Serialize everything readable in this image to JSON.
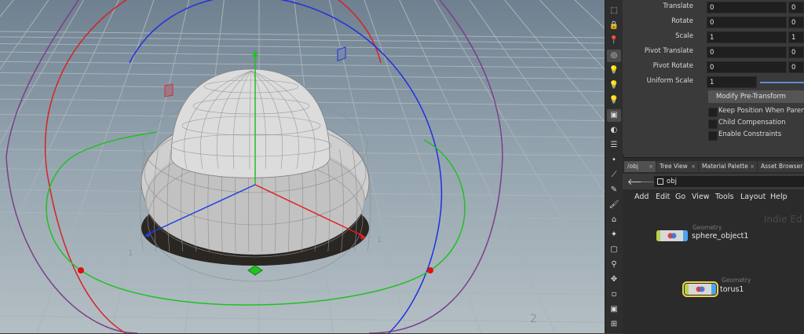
{
  "parameters": [
    {
      "label": "Translate",
      "values": [
        "0",
        "0"
      ]
    },
    {
      "label": "Rotate",
      "values": [
        "0",
        "0"
      ]
    },
    {
      "label": "Scale",
      "values": [
        "1",
        "1"
      ]
    },
    {
      "label": "Pivot Translate",
      "values": [
        "0",
        "0"
      ]
    },
    {
      "label": "Pivot Rotate",
      "values": [
        "0",
        "0"
      ]
    },
    {
      "label": "Uniform Scale",
      "values": [
        "1"
      ]
    }
  ],
  "pretransform_button": "Modify Pre-Transform",
  "checkboxes": [
    {
      "label": "Keep Position When Parenting",
      "checked": false
    },
    {
      "label": "Child Compensation",
      "checked": false
    },
    {
      "label": "Enable Constraints",
      "checked": false
    }
  ],
  "tabs": [
    "/obj",
    "Tree View",
    "Material Palette",
    "Asset Browser"
  ],
  "path": "obj",
  "menu": [
    "Add",
    "Edit",
    "Go",
    "View",
    "Tools",
    "Layout",
    "Help"
  ],
  "watermark": "Indie Ed",
  "nodes": [
    {
      "type": "Geometry",
      "name": "sphere_object1",
      "selected": false
    },
    {
      "type": "Geometry",
      "name": "torus1",
      "selected": true
    }
  ],
  "viewport": {
    "axis_colors": {
      "x": "#e02020",
      "y": "#20c020",
      "z": "#2040e0"
    },
    "handle_labels": [
      "1",
      "1",
      "2"
    ]
  },
  "shelf_icons": [
    "select-icon",
    "lock-icon",
    "pin-icon",
    "snap-icon",
    "light-icon",
    "light-alt-icon",
    "camera-light-icon",
    "scene-icon",
    "display-icon",
    "render-icon",
    "dot-icon",
    "brush-icon",
    "knife-icon",
    "paint-icon",
    "house-icon",
    "shape-icon",
    "box-icon",
    "rig-icon",
    "bone-icon",
    "square-icon",
    "camera-icon",
    "display-alt-icon"
  ]
}
